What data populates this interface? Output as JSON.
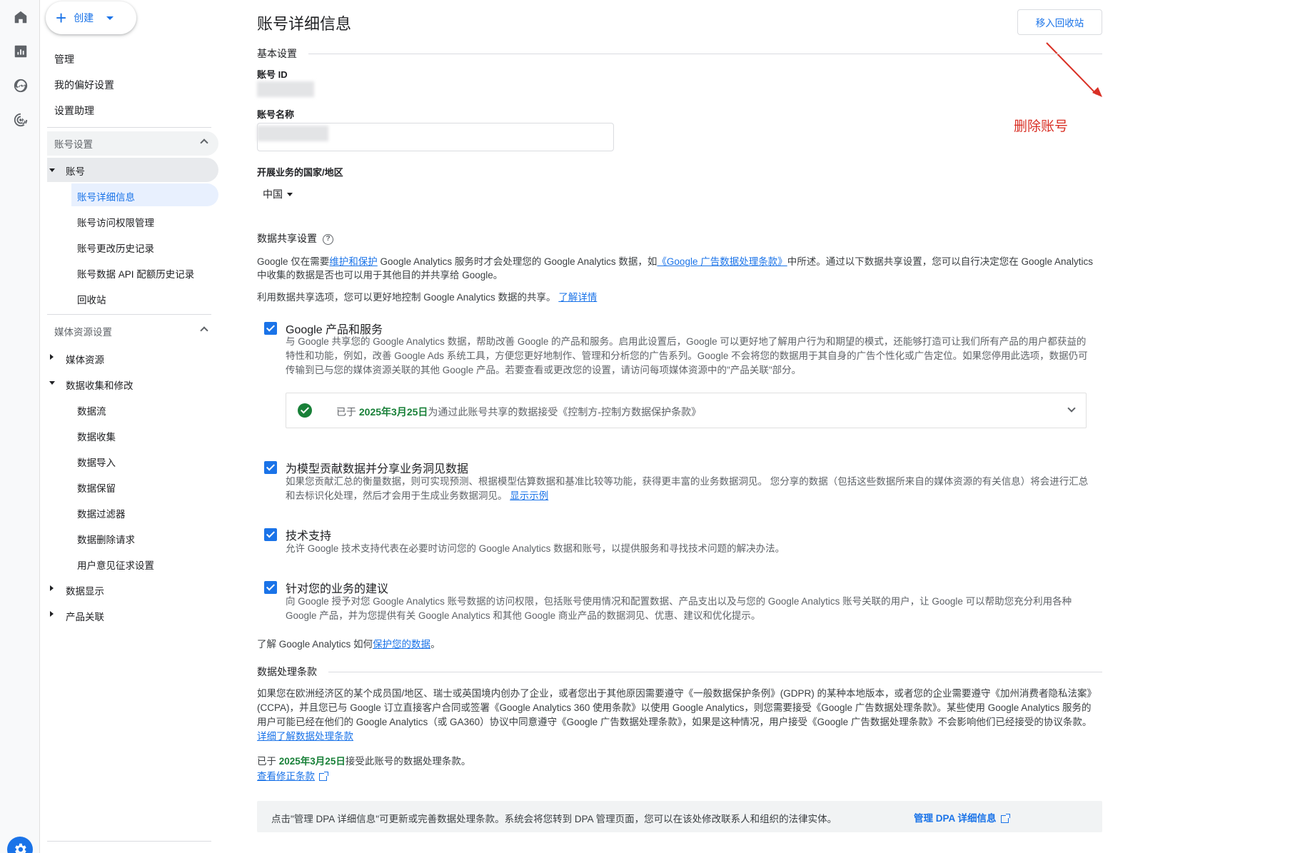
{
  "rail": {
    "icons": [
      "home-icon",
      "reports-icon",
      "explore-icon",
      "advertising-icon"
    ],
    "settings_icon": "gear-icon"
  },
  "nav": {
    "create_label": "创建",
    "top_items": [
      "管理",
      "我的偏好设置",
      "设置助理"
    ],
    "account_section": "账号设置",
    "account_group": "账号",
    "account_items": [
      "账号详细信息",
      "账号访问权限管理",
      "账号更改历史记录",
      "账号数据 API 配额历史记录",
      "回收站"
    ],
    "property_section": "媒体资源设置",
    "property_groups": {
      "media": "媒体资源",
      "collection": "数据收集和修改",
      "display": "数据显示",
      "links": "产品关联"
    },
    "collection_items": [
      "数据流",
      "数据收集",
      "数据导入",
      "数据保留",
      "数据过滤器",
      "数据删除请求",
      "用户意见征求设置"
    ]
  },
  "main": {
    "title": "账号详细信息",
    "trash_button": "移入回收站",
    "annotation": "删除账号",
    "basic_settings": "基本设置",
    "account_id_label": "账号 ID",
    "account_name_label": "账号名称",
    "country_label": "开展业务的国家/地区",
    "country_value": "中国",
    "sharing": {
      "heading": "数据共享设置",
      "intro_1": "Google 仅在需要",
      "intro_link_1": "维护和保护",
      "intro_2": " Google Analytics 服务时才会处理您的 Google Analytics 数据，如",
      "intro_link_2": "《Google 广告数据处理条款》",
      "intro_3": "中所述。通过以下数据共享设置，您可以自行决定您在 Google Analytics 中收集的数据是否也可以用于其他目的并共享给 Google。",
      "more_text": "利用数据共享选项，您可以更好地控制 Google Analytics 数据的共享。",
      "more_link": "了解详情",
      "options": [
        {
          "title": "Google 产品和服务",
          "desc": "与 Google 共享您的 Google Analytics 数据，帮助改善 Google 的产品和服务。启用此设置后，Google 可以更好地了解用户行为和期望的模式，还能够打造可让我们所有产品的用户都获益的特性和功能，例如，改善 Google Ads 系统工具，方便您更好地制作、管理和分析您的广告系列。Google 不会将您的数据用于其自身的广告个性化或广告定位。如果您停用此选项，数据仍可传输到已与您的媒体资源关联的其他 Google 产品。若要查看或更改您的设置，请访问每项媒体资源中的\"产品关联\"部分。"
        },
        {
          "title": "为模型贡献数据并分享业务洞见数据",
          "desc": "如果您贡献汇总的衡量数据，则可实现预测、根据模型估算数据和基准比较等功能，获得更丰富的业务数据洞见。 您分享的数据（包括这些数据所来自的媒体资源的有关信息）将会进行汇总和去标识化处理，然后才会用于生成业务数据洞见。",
          "link": "显示示例"
        },
        {
          "title": "技术支持",
          "desc": "允许 Google 技术支持代表在必要时访问您的 Google Analytics 数据和账号，以提供服务和寻找技术问题的解决办法。"
        },
        {
          "title": "针对您的业务的建议",
          "desc": "向 Google 授予对您 Google Analytics 账号数据的访问权限，包括账号使用情况和配置数据、产品支出以及与您的 Google Analytics 账号关联的用户，让 Google 可以帮助您充分利用各种 Google 产品，并为您提供有关 Google Analytics 和其他 Google 商业产品的数据洞见、优惠、建议和优化提示。"
        }
      ],
      "consent_prefix": "已于 ",
      "consent_date": "2025年3月25日",
      "consent_suffix": "为通过此账号共享的数据接受《控制方-控制方数据保护条款》",
      "protect_text": "了解 Google Analytics 如何",
      "protect_link": "保护您的数据",
      "protect_end": "。"
    },
    "dpa": {
      "heading": "数据处理条款",
      "body": "如果您在欧洲经济区的某个成员国/地区、瑞士或英国境内创办了企业，或者您出于其他原因需要遵守《一般数据保护条例》(GDPR) 的某种本地版本，或者您的企业需要遵守《加州消费者隐私法案》(CCPA)，并且您已与 Google 订立直接客户合同或签署《Google Analytics 360 使用条款》以使用 Google Analytics，则您需要接受《Google 广告数据处理条款》。某些使用 Google Analytics 服务的用户可能已经在他们的 Google Analytics（或 GA360）协议中同意遵守《Google 广告数据处理条款》，如果是这种情况，用户接受《Google 广告数据处理条款》不会影响他们已经接受的协议条款。",
      "body_link": "详细了解数据处理条款",
      "accepted_prefix": "已于 ",
      "accepted_date": "2025年3月25日",
      "accepted_suffix": "接受此账号的数据处理条款。",
      "amend_link": "查看修正条款",
      "bar_text": "点击\"管理 DPA 详细信息\"可更新或完善数据处理条款。系统会将您转到 DPA 管理页面，您可以在该处修改联系人和组织的法律实体。",
      "bar_link": "管理 DPA 详细信息"
    }
  },
  "colors": {
    "accent": "#1a73e8",
    "success": "#188038",
    "annotation": "#d93025"
  }
}
